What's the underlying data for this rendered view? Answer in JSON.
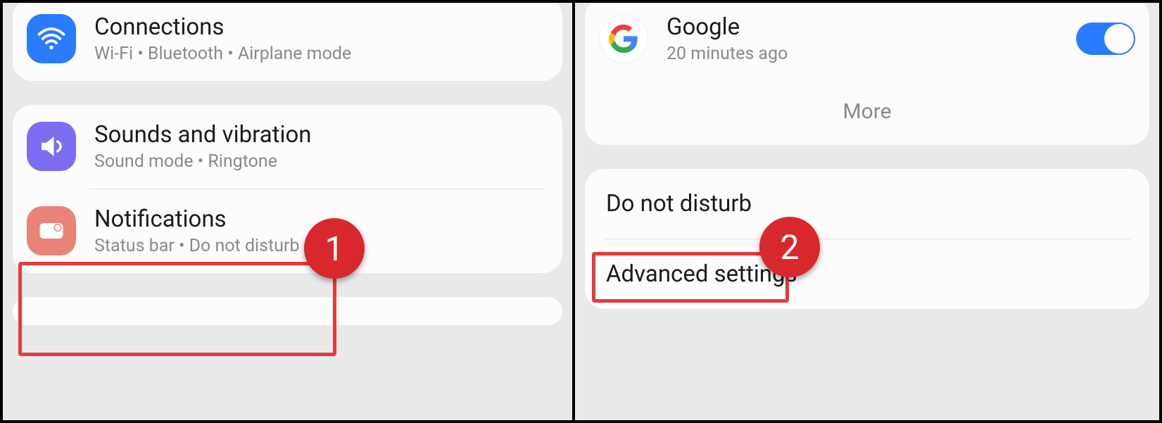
{
  "left": {
    "connections": {
      "title": "Connections",
      "sub": "Wi-Fi  •  Bluetooth  •  Airplane mode"
    },
    "sounds": {
      "title": "Sounds and vibration",
      "sub": "Sound mode  •  Ringtone"
    },
    "notifications": {
      "title": "Notifications",
      "sub": "Status bar  •  Do not disturb"
    },
    "callout_number": "1"
  },
  "right": {
    "google": {
      "title": "Google",
      "sub": "20 minutes ago",
      "toggle_on": true
    },
    "more_label": "More",
    "dnd_label": "Do not disturb",
    "advanced_label": "Advanced settings",
    "callout_number": "2"
  }
}
